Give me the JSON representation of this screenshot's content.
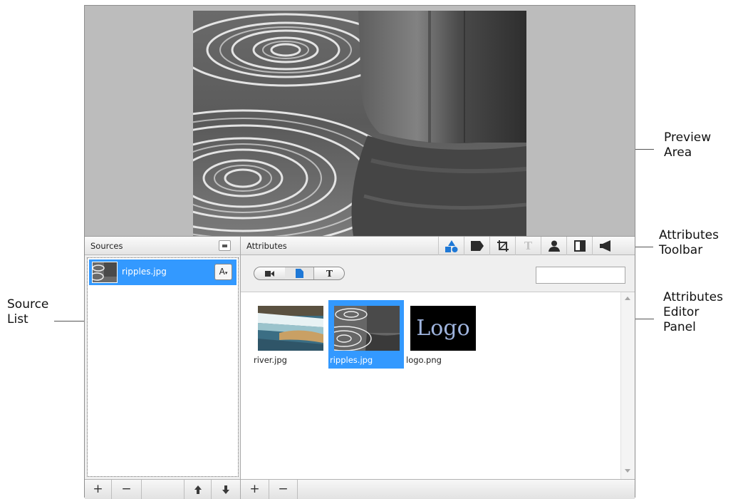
{
  "callouts": {
    "preview": [
      "Preview",
      "Area"
    ],
    "toolbar": [
      "Attributes",
      "Toolbar"
    ],
    "editor": [
      "Attributes",
      "Editor",
      "Panel"
    ],
    "source": [
      "Source",
      "List"
    ]
  },
  "sources": {
    "title": "Sources",
    "items": [
      {
        "name": "ripples.jpg",
        "badge": "A"
      }
    ],
    "bottom": {
      "add": "+",
      "remove": "−"
    }
  },
  "attributes": {
    "title": "Attributes",
    "toolbar_icons": [
      "shapes-icon",
      "tag-icon",
      "crop-icon",
      "text-icon",
      "person-icon",
      "split-view-icon",
      "audio-icon"
    ],
    "type_filter": {
      "text_label": "T"
    },
    "search": {
      "value": ""
    },
    "thumbnails": [
      {
        "name": "river.jpg",
        "selected": false
      },
      {
        "name": "ripples.jpg",
        "selected": true
      },
      {
        "name": "logo.png",
        "selected": false,
        "logo_text": "Logo"
      }
    ],
    "bottom": {
      "add": "+",
      "remove": "−"
    }
  },
  "colors": {
    "selection": "#3399ff",
    "accent_blue": "#1e78d6"
  }
}
